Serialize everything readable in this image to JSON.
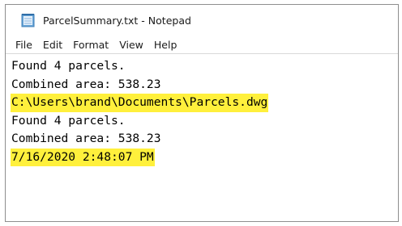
{
  "window": {
    "title": "ParcelSummary.txt - Notepad"
  },
  "menu": [
    "File",
    "Edit",
    "Format",
    "View",
    "Help"
  ],
  "lines": [
    {
      "text": "Found 4 parcels.",
      "highlighted": false
    },
    {
      "text": "Combined area: 538.23",
      "highlighted": false
    },
    {
      "text": "C:\\Users\\brand\\Documents\\Parcels.dwg",
      "highlighted": true
    },
    {
      "text": "Found 4 parcels.",
      "highlighted": false
    },
    {
      "text": "Combined area: 538.23",
      "highlighted": false
    },
    {
      "text": "7/16/2020 2:48:07 PM",
      "highlighted": true
    }
  ],
  "colors": {
    "highlight": "#fff03c",
    "border": "#8e8e8e"
  },
  "icons": {
    "app": "notepad-icon"
  }
}
